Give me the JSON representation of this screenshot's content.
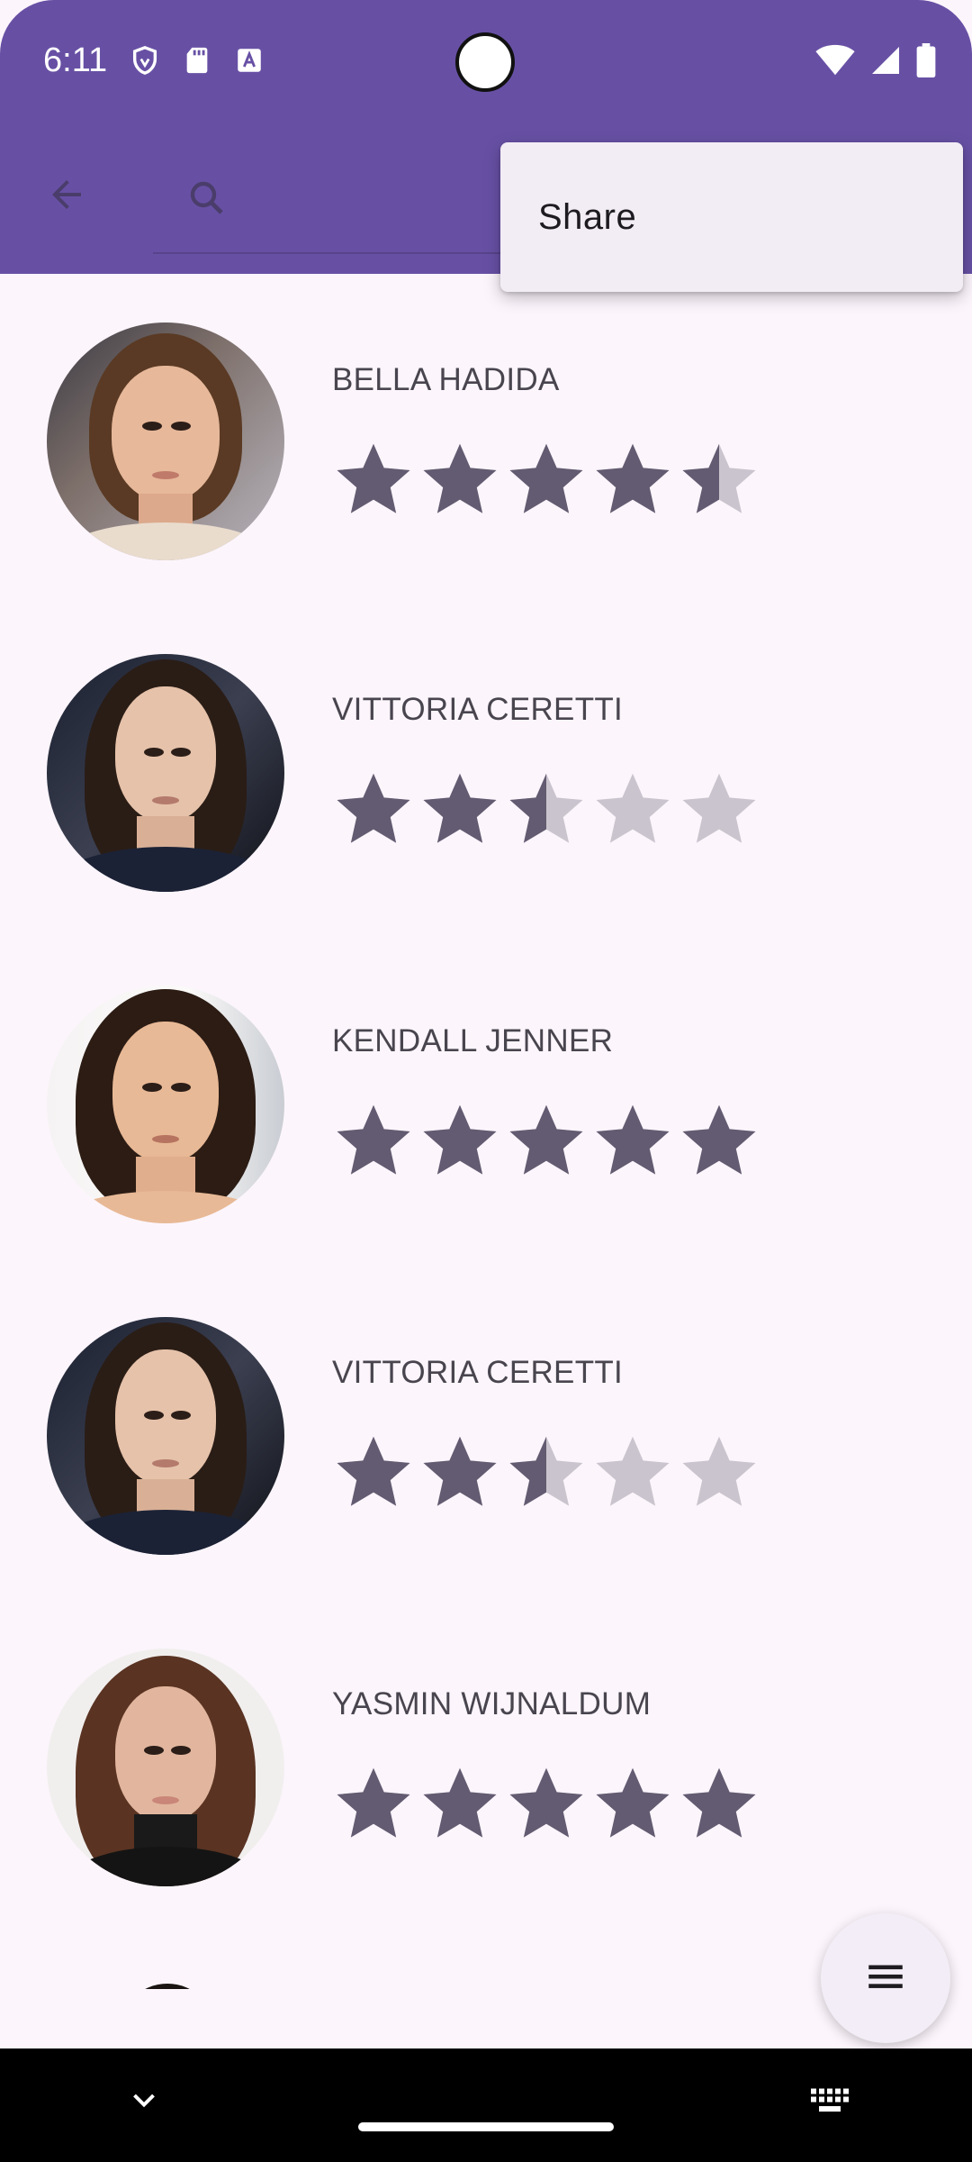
{
  "status_bar": {
    "time": "6:11",
    "left_icons": [
      "shield-icon",
      "sd-card-icon",
      "text-icon"
    ],
    "right_icons": [
      "wifi-icon",
      "signal-icon",
      "battery-icon"
    ]
  },
  "toolbar": {
    "back_icon": "arrow-back-icon",
    "search_icon": "search-icon",
    "background_color": "#6750A4"
  },
  "popup_menu": {
    "items": [
      {
        "label": "Share"
      }
    ]
  },
  "list": {
    "items": [
      {
        "name": "BELLA HADIDA",
        "rating": 4.5
      },
      {
        "name": "VITTORIA CERETTI",
        "rating": 2.5
      },
      {
        "name": "KENDALL JENNER",
        "rating": 5
      },
      {
        "name": "VITTORIA CERETTI",
        "rating": 2.5
      },
      {
        "name": "YASMIN WIJNALDUM",
        "rating": 5
      }
    ],
    "max_rating": 5,
    "star_color": "#625B71",
    "star_empty_color": "#CAC4CE"
  },
  "fab": {
    "icon": "menu-icon"
  },
  "nav_bar": {
    "collapse_icon": "chevron-down-icon",
    "keyboard_icon": "keyboard-icon"
  }
}
